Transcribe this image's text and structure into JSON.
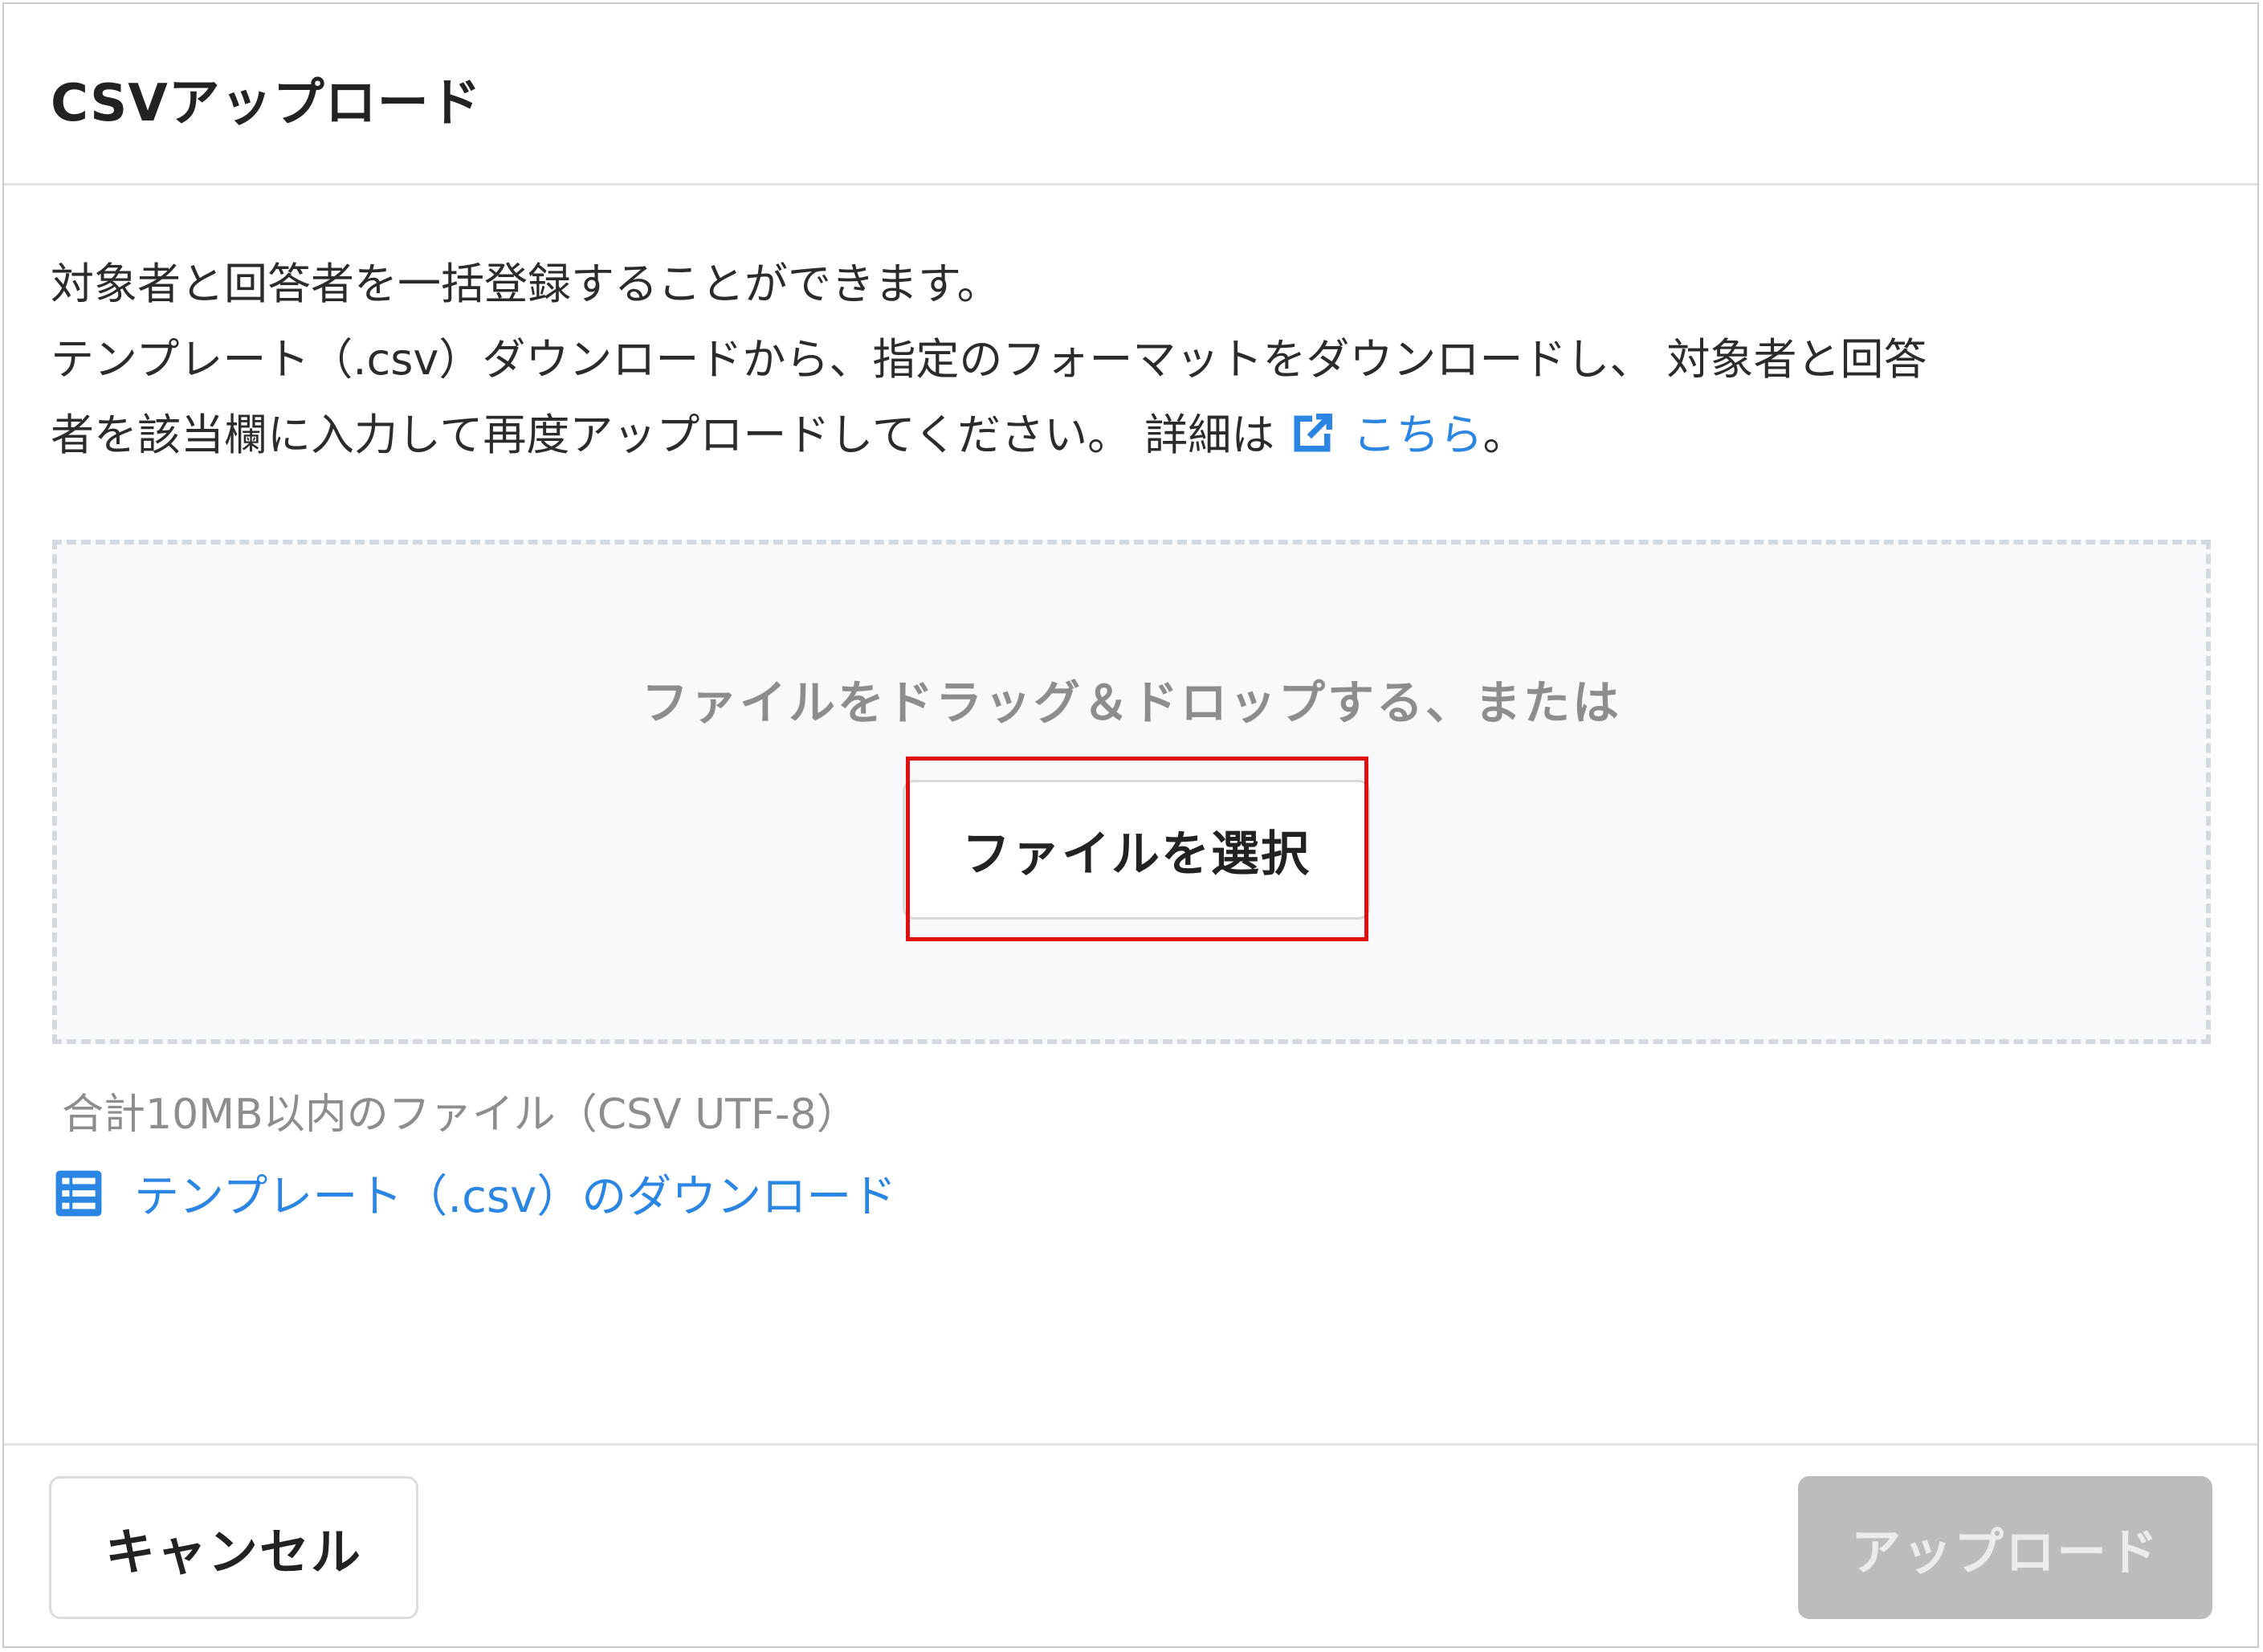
{
  "dialog": {
    "title": "CSVアップロード"
  },
  "description": {
    "line1": "対象者と回答者を一括登録することができます。",
    "line2": "テンプレート（.csv）ダウンロードから、指定のフォーマットをダウンロードし、 対象者と回答",
    "line3_prefix": "者を該当欄に入力して再度アップロードしてください。 詳細は",
    "link_icon": "external-link-icon",
    "link_text": "こちら",
    "line3_suffix": "。"
  },
  "dropzone": {
    "prompt": "ファイルをドラッグ＆ドロップする、または",
    "select_button_label": "ファイルを選択"
  },
  "note": "合計10MB以内のファイル（CSV UTF-8）",
  "template_download": {
    "icon": "table-icon",
    "label": "テンプレート（.csv）のダウンロード"
  },
  "footer": {
    "cancel_label": "キャンセル",
    "upload_label": "アップロード",
    "upload_disabled": true
  },
  "colors": {
    "link": "#2b86e3",
    "highlight": "#e01010",
    "disabled_button": "#bcbcbc"
  }
}
